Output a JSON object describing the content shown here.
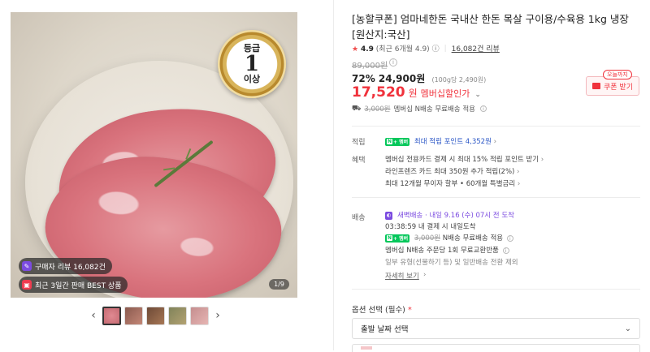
{
  "gallery": {
    "medal_big": "1",
    "medal_small_top": "등급",
    "medal_small_bottom": "이상",
    "badge_review": "구매자 리뷰 16,082건",
    "badge_best": "최근 3일간 판매 BEST 상품",
    "counter": "1/9",
    "prev_arrow": "‹",
    "next_arrow": "›"
  },
  "product": {
    "title": "[농할쿠폰] 엄마네한돈 국내산 한돈 목살 구이용/수육용 1kg 냉장 [원산지:국산]",
    "rating_star": "★",
    "rating_score": "4.9",
    "rating_recent": "(최근 6개월 4.9)",
    "rating_info": "ⓘ",
    "review_count": "16,082건 리뷰",
    "original_price": "89,000원",
    "discount_rate": "72%",
    "sale_price": "24,900원",
    "unit_price": "(100g당 2,490원)",
    "member_price": "17,520",
    "member_won": "원",
    "member_label": "멤버십할인가",
    "member_chev": "⌄",
    "ship_old": "3,000원",
    "ship_text": "멤버십 N배송 무료배송 적용",
    "coupon_today": "오늘까지",
    "coupon_btn": "쿠폰 받기"
  },
  "points": {
    "label": "적립",
    "npay_text": "최대 적립 포인트 4,352원"
  },
  "benefits": {
    "label": "혜택",
    "lines": [
      "멤버십 전용카드 결제 시 최대 15% 적립 포인트 받기",
      "라인프렌즈 카드 최대 350원 추가 적립(2%)",
      "최대 12개월 무이자 할부 • 60개월 특별금리"
    ]
  },
  "delivery": {
    "label": "배송",
    "dawn": "새벽배송",
    "dawn_detail": " · 내일 9.16 (수) 07시 전 도착",
    "countdown": "03:38:59",
    "countdown_text": "내 결제 시 내일도착",
    "ship_old": "3,000원",
    "ship_free": "N배송 무료배송 적용",
    "return_text": "멤버십 N배송 주문당 1회 무료교환반품",
    "exclude_text": "일부 유형(선물하기 등) 및 일반배송 전환 제외",
    "more": "자세히 보기"
  },
  "options": {
    "label": "옵션 선택 (필수)",
    "req": "*",
    "select_value": "출발 날짜 선택",
    "chev": "⌄"
  },
  "colors": {
    "accent_red": "#f0323c",
    "npay_green": "#03c75a",
    "link_blue": "#2a56c6"
  }
}
